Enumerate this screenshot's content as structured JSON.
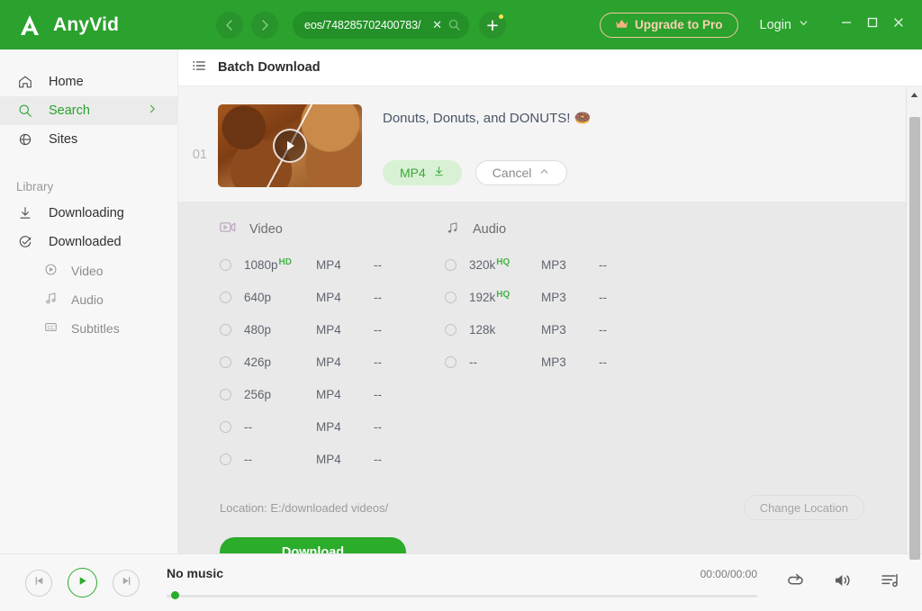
{
  "titlebar": {
    "brand": "AnyVid",
    "logo_icon": "anyvid-logo-icon",
    "back_icon": "chevron-left-icon",
    "forward_icon": "chevron-right-icon",
    "url_value": "eos/748285702400783/",
    "url_clear_icon": "close-icon",
    "url_search_icon": "search-icon",
    "new_tab_icon": "plus-icon",
    "upgrade_label": "Upgrade to Pro",
    "upgrade_icon": "crown-icon",
    "login_label": "Login",
    "login_chevron_icon": "chevron-down-icon",
    "minimize_icon": "minimize-icon",
    "maximize_icon": "maximize-icon",
    "close_icon": "close-icon",
    "accent_color": "#2ba12e",
    "upgrade_color": "#f6d3ad"
  },
  "sidebar": {
    "items": [
      {
        "label": "Home",
        "icon": "home-icon",
        "active": false
      },
      {
        "label": "Search",
        "icon": "search-icon",
        "active": true
      },
      {
        "label": "Sites",
        "icon": "globe-icon",
        "active": false
      }
    ],
    "library_label": "Library",
    "library_items": [
      {
        "label": "Downloading",
        "icon": "download-icon"
      },
      {
        "label": "Downloaded",
        "icon": "check-circle-icon"
      }
    ],
    "sub_items": [
      {
        "label": "Video",
        "icon": "play-circle-icon"
      },
      {
        "label": "Audio",
        "icon": "music-note-icon"
      },
      {
        "label": "Subtitles",
        "icon": "cc-icon"
      }
    ]
  },
  "content": {
    "header_title": "Batch Download",
    "header_icon": "list-icon",
    "card": {
      "index": "01",
      "thumbnail_icon": "video-thumbnail",
      "play_overlay_icon": "play-icon",
      "title": "Donuts, Donuts, and DONUTS! 🍩",
      "format_pill_label": "MP4",
      "format_pill_icon": "download-icon",
      "cancel_label": "Cancel",
      "cancel_icon": "chevron-up-icon"
    },
    "formats": {
      "video": {
        "heading": "Video",
        "icon": "video-camera-icon",
        "rows": [
          {
            "quality": "1080p",
            "badge": "HD",
            "format": "MP4",
            "size": "--"
          },
          {
            "quality": "640p",
            "badge": "",
            "format": "MP4",
            "size": "--"
          },
          {
            "quality": "480p",
            "badge": "",
            "format": "MP4",
            "size": "--"
          },
          {
            "quality": "426p",
            "badge": "",
            "format": "MP4",
            "size": "--"
          },
          {
            "quality": "256p",
            "badge": "",
            "format": "MP4",
            "size": "--"
          },
          {
            "quality": "--",
            "badge": "",
            "format": "MP4",
            "size": "--"
          },
          {
            "quality": "--",
            "badge": "",
            "format": "MP4",
            "size": "--"
          }
        ]
      },
      "audio": {
        "heading": "Audio",
        "icon": "music-note-icon",
        "rows": [
          {
            "quality": "320k",
            "badge": "HQ",
            "format": "MP3",
            "size": "--"
          },
          {
            "quality": "192k",
            "badge": "HQ",
            "format": "MP3",
            "size": "--"
          },
          {
            "quality": "128k",
            "badge": "",
            "format": "MP3",
            "size": "--"
          },
          {
            "quality": "--",
            "badge": "",
            "format": "MP3",
            "size": "--"
          }
        ]
      },
      "location_label": "Location: E:/downloaded videos/",
      "change_location_label": "Change Location",
      "download_label": "Download"
    }
  },
  "scrollbar": {
    "up_icon": "triangle-up-icon",
    "down_icon": "triangle-down-icon"
  },
  "player": {
    "prev_icon": "skip-previous-icon",
    "play_icon": "play-icon",
    "next_icon": "skip-next-icon",
    "track_name": "No music",
    "time": "00:00/00:00",
    "repeat_icon": "repeat-icon",
    "volume_icon": "volume-icon",
    "playlist_icon": "playlist-icon",
    "progress_percent": 0
  }
}
